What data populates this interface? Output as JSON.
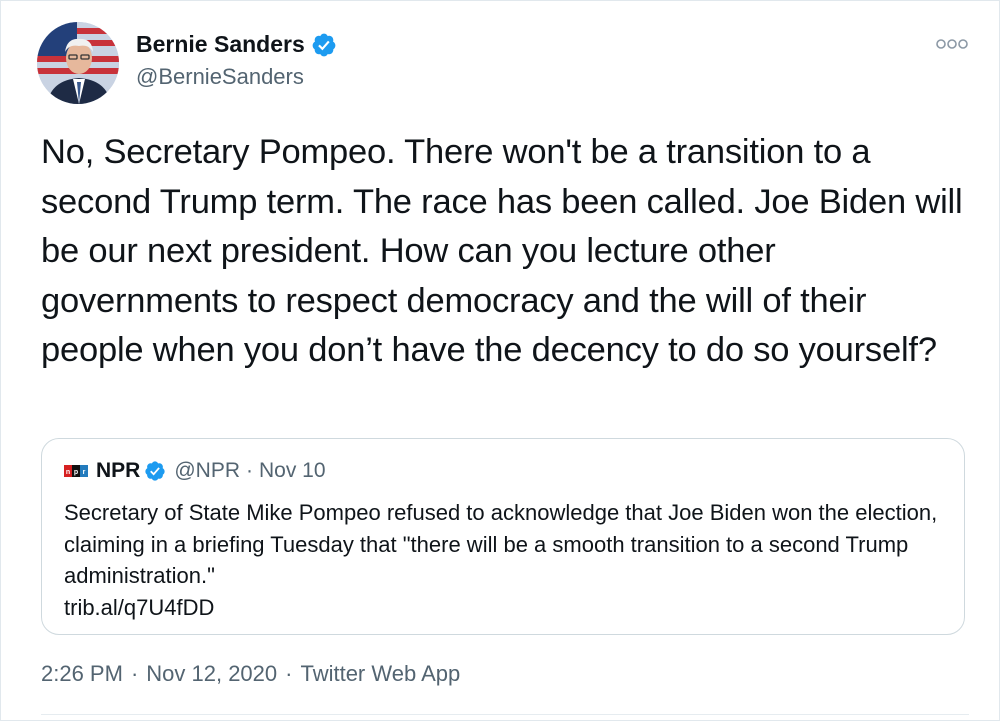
{
  "tweet": {
    "author": {
      "display_name": "Bernie Sanders",
      "handle": "@BernieSanders",
      "verified": true
    },
    "text": "No, Secretary Pompeo. There won't be a transition to a second Trump term. The race has been called. Joe Biden will be our next president. How can you lecture other governments to respect democracy and the will of their people when you don’t have the decency to do so yourself?",
    "more_icon": "more-options-icon",
    "quoted": {
      "logo": "npr-logo-icon",
      "display_name": "NPR",
      "handle": "@NPR",
      "separator": "·",
      "date": "Nov 10",
      "text": "Secretary of State Mike Pompeo refused to acknowledge that Joe Biden won the election, claiming in a briefing Tuesday that \"there will be a smooth transition to a second Trump administration.\"",
      "link": "trib.al/q7U4fDD"
    },
    "meta": {
      "time": "2:26 PM",
      "separator": "·",
      "date": "Nov 12, 2020",
      "source": "Twitter Web App"
    }
  },
  "colors": {
    "verified_blue": "#1d9bf0",
    "text_primary": "#0f1419",
    "text_secondary": "#536471",
    "border": "#cfd9de"
  }
}
